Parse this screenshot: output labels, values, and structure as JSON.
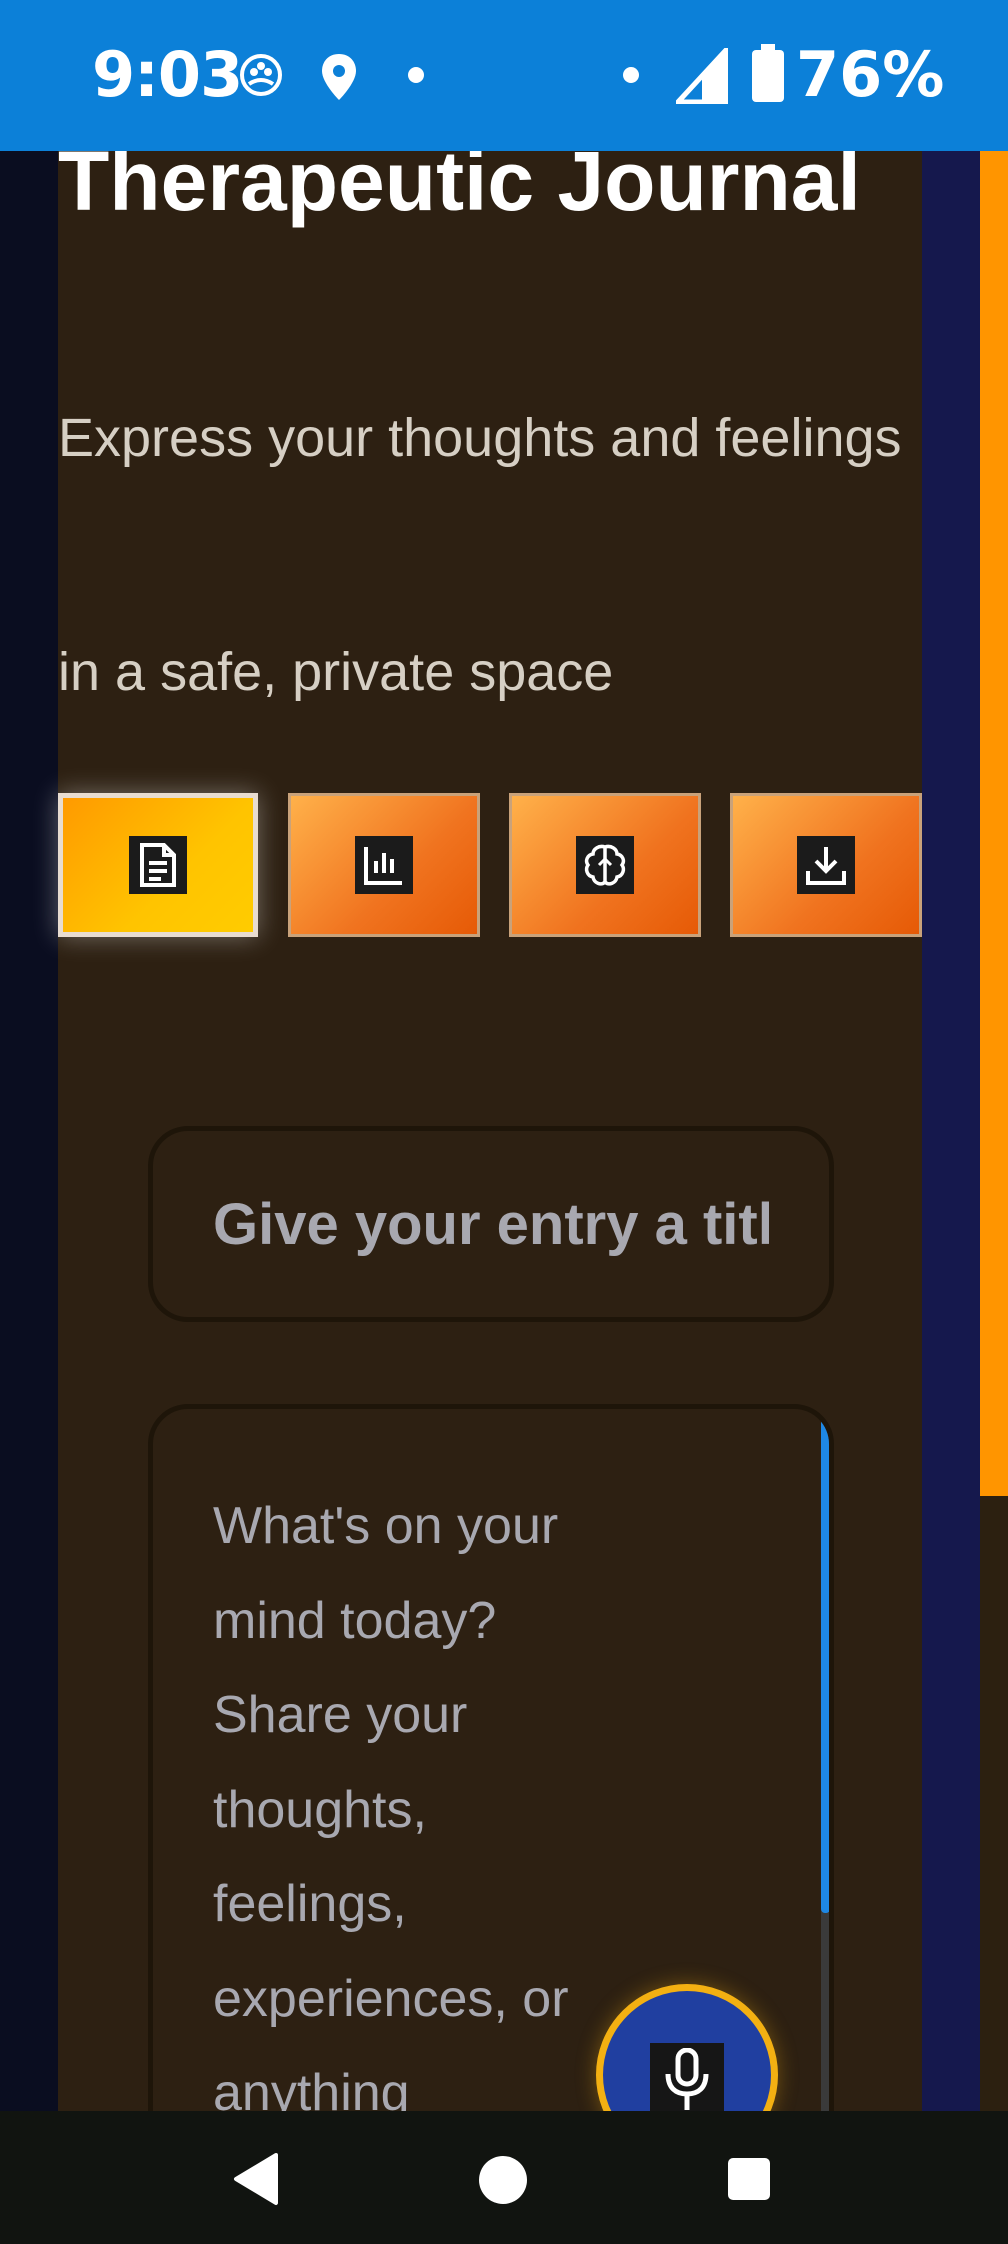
{
  "status_bar": {
    "time": "9:03",
    "battery": "76%",
    "icons": [
      "app-icon",
      "location-icon",
      "dot-icon",
      "dot-icon",
      "signal-icon",
      "battery-icon"
    ]
  },
  "header": {
    "title": "Therapeutic Journal",
    "subtitle": "Express your thoughts and feelings in a safe, private space"
  },
  "toolbar": {
    "buttons": [
      {
        "icon": "document-icon",
        "active": true
      },
      {
        "icon": "bar-chart-icon",
        "active": false
      },
      {
        "icon": "brain-icon",
        "active": false
      },
      {
        "icon": "download-icon",
        "active": false
      }
    ]
  },
  "editor": {
    "title_placeholder": "Give your entry a title...",
    "body_placeholder": "What's on your mind today? Share your thoughts, feelings, experiences, or anything"
  },
  "fab": {
    "icon": "microphone-icon"
  },
  "nav": {
    "icons": [
      "back-icon",
      "home-icon",
      "recents-icon"
    ]
  },
  "colors": {
    "accent": "#ff9500",
    "status_bar": "#0c80d8",
    "main_bg": "#2d2012",
    "fab_bg": "#203fa0",
    "fab_ring": "#f3b012"
  }
}
